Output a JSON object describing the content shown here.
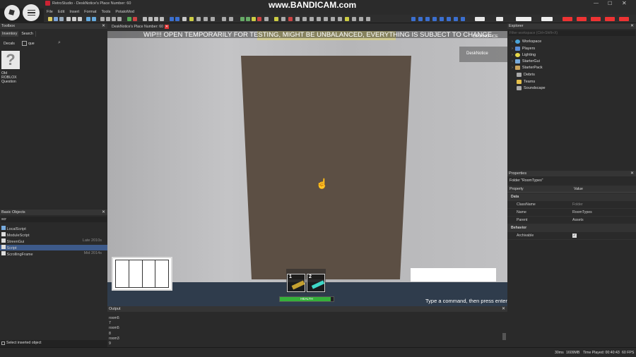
{
  "window": {
    "title": "RetroStudio - DeskNotice's Place Number: 60",
    "recording_watermark": "www.BANDICAM.com"
  },
  "menu": [
    "File",
    "Edit",
    "Insert",
    "Format",
    "Tools",
    "PotatoMod"
  ],
  "viewport": {
    "tab_title": "DeskNotice's Place Number: 60",
    "banner": "WIP!!! OPEN TEMPORARILY FOR TESTING, MIGHT BE UNBALANCED, EVERYTHING IS SUBJECT TO CHANGE",
    "player_name": "DeskNotice",
    "player_name_partial": "DESKNOTICE",
    "hotbar": [
      {
        "slot": "1"
      },
      {
        "slot": "2"
      }
    ],
    "health_label": "HEALTH",
    "health_fraction": 0.95,
    "command_hint": "Type a command, then press enter.",
    "colors": {
      "wall": "#b9b9bb",
      "door": "#5c4f44",
      "floor": "#2f3c4c",
      "health": "#35b03a"
    }
  },
  "toolbox": {
    "title": "Toolbox",
    "tabs": [
      "Inventory",
      "Search"
    ],
    "category": "Decals",
    "search_value": "que",
    "item": {
      "label": "Old ROBLOX Question",
      "icon": "question-mark-icon"
    }
  },
  "basic_objects": {
    "title": "Basic Objects",
    "filter": "scr",
    "items": [
      {
        "name": "LocalScript",
        "note": ""
      },
      {
        "name": "ModuleScript",
        "note": ""
      },
      {
        "name": "StreenGui",
        "note": "Late 2010s"
      },
      {
        "name": "Script",
        "note": ""
      },
      {
        "name": "ScrollingFrame",
        "note": "Mid 2014s"
      }
    ],
    "footer": "Select inserted object"
  },
  "explorer": {
    "title": "Explorer",
    "filter_placeholder": "Filter workspace (Ctrl+Shift+X)",
    "items": [
      "Workspace",
      "Players",
      "Lighting",
      "StarterGui",
      "StarterPack",
      "Debris",
      "Teams",
      "Soundscape"
    ]
  },
  "properties": {
    "title": "Properties",
    "selection": "Folder \"RoomTypes\"",
    "col_property": "Property",
    "col_value": "Value",
    "sections": {
      "data": "Data",
      "behavior": "Behavior"
    },
    "rows": [
      {
        "k": "ClassName",
        "v": "Folder"
      },
      {
        "k": "Name",
        "v": "RoomTypes"
      },
      {
        "k": "Parent",
        "v": "Assets"
      }
    ],
    "archivable": "Archivable"
  },
  "output": {
    "title": "Output",
    "lines": [
      "room5",
      "7",
      "room5",
      "8",
      "room3",
      "9"
    ]
  },
  "status": {
    "ping": "30ms",
    "memory": "1609MB",
    "time_played": "Time Played: 00:40:43",
    "fps": "60 FPS"
  }
}
